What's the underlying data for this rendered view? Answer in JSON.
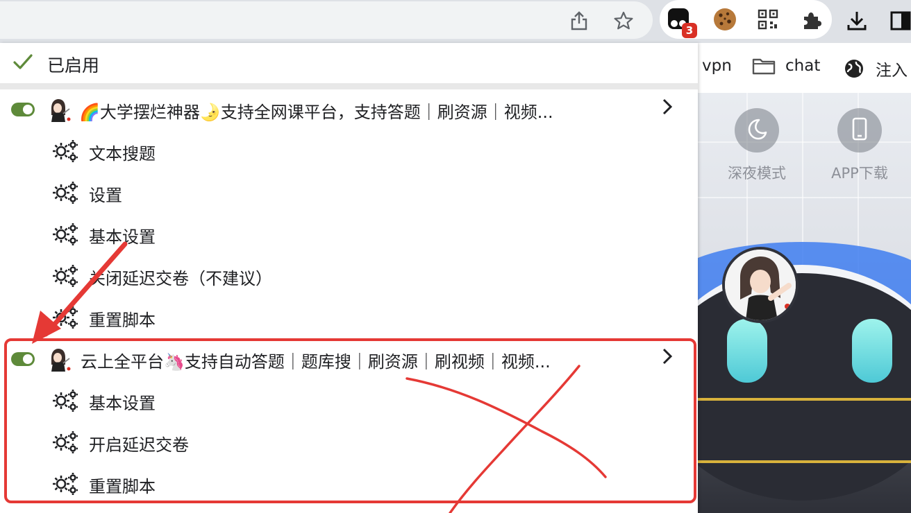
{
  "toolbar": {
    "share_icon": "share-icon",
    "bookmark_icon": "star-icon",
    "extensions": [
      {
        "name": "tampermonkey-icon",
        "badge": "3"
      },
      {
        "name": "cookie-icon"
      },
      {
        "name": "qr-code-icon"
      },
      {
        "name": "puzzle-icon"
      }
    ],
    "download_icon": "download-icon",
    "side_panel_icon": "side-panel-icon"
  },
  "bookmarks": [
    {
      "label": "vpn",
      "icon": "none"
    },
    {
      "label": "chat",
      "icon": "folder-icon"
    },
    {
      "label": "注入",
      "icon": "globe-icon"
    }
  ],
  "site": {
    "night_mode_label": "深夜模式",
    "app_download_label": "APP下载"
  },
  "popup": {
    "enabled_label": "已启用",
    "scripts": [
      {
        "title": "🌈大学摆烂神器🌛支持全网课平台，支持答题｜刷资源｜视频...",
        "enabled": true,
        "commands": [
          "文本搜题",
          "设置",
          "基本设置",
          "关闭延迟交卷（不建议）",
          "重置脚本"
        ]
      },
      {
        "title": "云上全平台🦄支持自动答题｜题库搜｜刷资源｜刷视频｜视频...",
        "enabled": true,
        "commands": [
          "基本设置",
          "开启延迟交卷",
          "重置脚本"
        ]
      }
    ]
  },
  "colors": {
    "toggle_on": "#5e8a3a",
    "check": "#5e8a3a",
    "annotation": "#e53935",
    "badge": "#d93025"
  }
}
